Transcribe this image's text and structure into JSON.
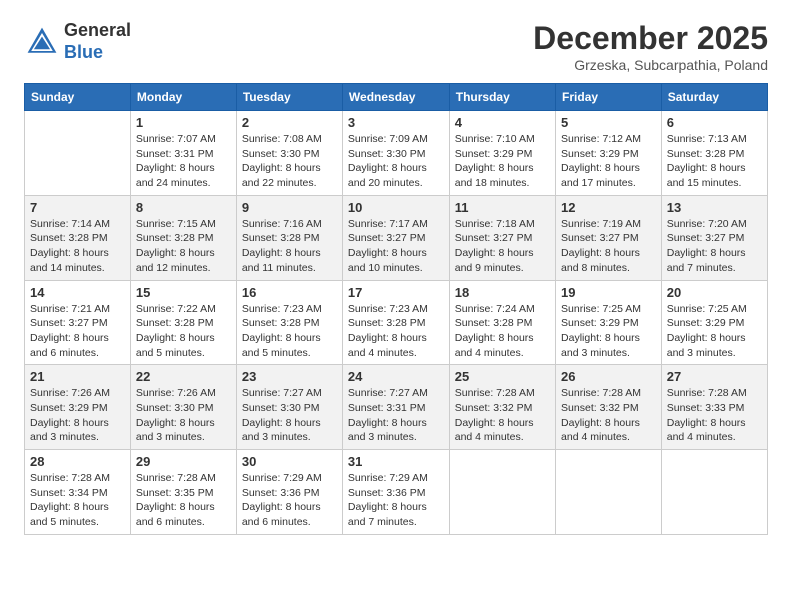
{
  "header": {
    "logo_line1": "General",
    "logo_line2": "Blue",
    "month_title": "December 2025",
    "location": "Grzeska, Subcarpathia, Poland"
  },
  "days_of_week": [
    "Sunday",
    "Monday",
    "Tuesday",
    "Wednesday",
    "Thursday",
    "Friday",
    "Saturday"
  ],
  "weeks": [
    [
      {
        "num": "",
        "info": ""
      },
      {
        "num": "1",
        "info": "Sunrise: 7:07 AM\nSunset: 3:31 PM\nDaylight: 8 hours\nand 24 minutes."
      },
      {
        "num": "2",
        "info": "Sunrise: 7:08 AM\nSunset: 3:30 PM\nDaylight: 8 hours\nand 22 minutes."
      },
      {
        "num": "3",
        "info": "Sunrise: 7:09 AM\nSunset: 3:30 PM\nDaylight: 8 hours\nand 20 minutes."
      },
      {
        "num": "4",
        "info": "Sunrise: 7:10 AM\nSunset: 3:29 PM\nDaylight: 8 hours\nand 18 minutes."
      },
      {
        "num": "5",
        "info": "Sunrise: 7:12 AM\nSunset: 3:29 PM\nDaylight: 8 hours\nand 17 minutes."
      },
      {
        "num": "6",
        "info": "Sunrise: 7:13 AM\nSunset: 3:28 PM\nDaylight: 8 hours\nand 15 minutes."
      }
    ],
    [
      {
        "num": "7",
        "info": "Sunrise: 7:14 AM\nSunset: 3:28 PM\nDaylight: 8 hours\nand 14 minutes."
      },
      {
        "num": "8",
        "info": "Sunrise: 7:15 AM\nSunset: 3:28 PM\nDaylight: 8 hours\nand 12 minutes."
      },
      {
        "num": "9",
        "info": "Sunrise: 7:16 AM\nSunset: 3:28 PM\nDaylight: 8 hours\nand 11 minutes."
      },
      {
        "num": "10",
        "info": "Sunrise: 7:17 AM\nSunset: 3:27 PM\nDaylight: 8 hours\nand 10 minutes."
      },
      {
        "num": "11",
        "info": "Sunrise: 7:18 AM\nSunset: 3:27 PM\nDaylight: 8 hours\nand 9 minutes."
      },
      {
        "num": "12",
        "info": "Sunrise: 7:19 AM\nSunset: 3:27 PM\nDaylight: 8 hours\nand 8 minutes."
      },
      {
        "num": "13",
        "info": "Sunrise: 7:20 AM\nSunset: 3:27 PM\nDaylight: 8 hours\nand 7 minutes."
      }
    ],
    [
      {
        "num": "14",
        "info": "Sunrise: 7:21 AM\nSunset: 3:27 PM\nDaylight: 8 hours\nand 6 minutes."
      },
      {
        "num": "15",
        "info": "Sunrise: 7:22 AM\nSunset: 3:28 PM\nDaylight: 8 hours\nand 5 minutes."
      },
      {
        "num": "16",
        "info": "Sunrise: 7:23 AM\nSunset: 3:28 PM\nDaylight: 8 hours\nand 5 minutes."
      },
      {
        "num": "17",
        "info": "Sunrise: 7:23 AM\nSunset: 3:28 PM\nDaylight: 8 hours\nand 4 minutes."
      },
      {
        "num": "18",
        "info": "Sunrise: 7:24 AM\nSunset: 3:28 PM\nDaylight: 8 hours\nand 4 minutes."
      },
      {
        "num": "19",
        "info": "Sunrise: 7:25 AM\nSunset: 3:29 PM\nDaylight: 8 hours\nand 3 minutes."
      },
      {
        "num": "20",
        "info": "Sunrise: 7:25 AM\nSunset: 3:29 PM\nDaylight: 8 hours\nand 3 minutes."
      }
    ],
    [
      {
        "num": "21",
        "info": "Sunrise: 7:26 AM\nSunset: 3:29 PM\nDaylight: 8 hours\nand 3 minutes."
      },
      {
        "num": "22",
        "info": "Sunrise: 7:26 AM\nSunset: 3:30 PM\nDaylight: 8 hours\nand 3 minutes."
      },
      {
        "num": "23",
        "info": "Sunrise: 7:27 AM\nSunset: 3:30 PM\nDaylight: 8 hours\nand 3 minutes."
      },
      {
        "num": "24",
        "info": "Sunrise: 7:27 AM\nSunset: 3:31 PM\nDaylight: 8 hours\nand 3 minutes."
      },
      {
        "num": "25",
        "info": "Sunrise: 7:28 AM\nSunset: 3:32 PM\nDaylight: 8 hours\nand 4 minutes."
      },
      {
        "num": "26",
        "info": "Sunrise: 7:28 AM\nSunset: 3:32 PM\nDaylight: 8 hours\nand 4 minutes."
      },
      {
        "num": "27",
        "info": "Sunrise: 7:28 AM\nSunset: 3:33 PM\nDaylight: 8 hours\nand 4 minutes."
      }
    ],
    [
      {
        "num": "28",
        "info": "Sunrise: 7:28 AM\nSunset: 3:34 PM\nDaylight: 8 hours\nand 5 minutes."
      },
      {
        "num": "29",
        "info": "Sunrise: 7:28 AM\nSunset: 3:35 PM\nDaylight: 8 hours\nand 6 minutes."
      },
      {
        "num": "30",
        "info": "Sunrise: 7:29 AM\nSunset: 3:36 PM\nDaylight: 8 hours\nand 6 minutes."
      },
      {
        "num": "31",
        "info": "Sunrise: 7:29 AM\nSunset: 3:36 PM\nDaylight: 8 hours\nand 7 minutes."
      },
      {
        "num": "",
        "info": ""
      },
      {
        "num": "",
        "info": ""
      },
      {
        "num": "",
        "info": ""
      }
    ]
  ]
}
